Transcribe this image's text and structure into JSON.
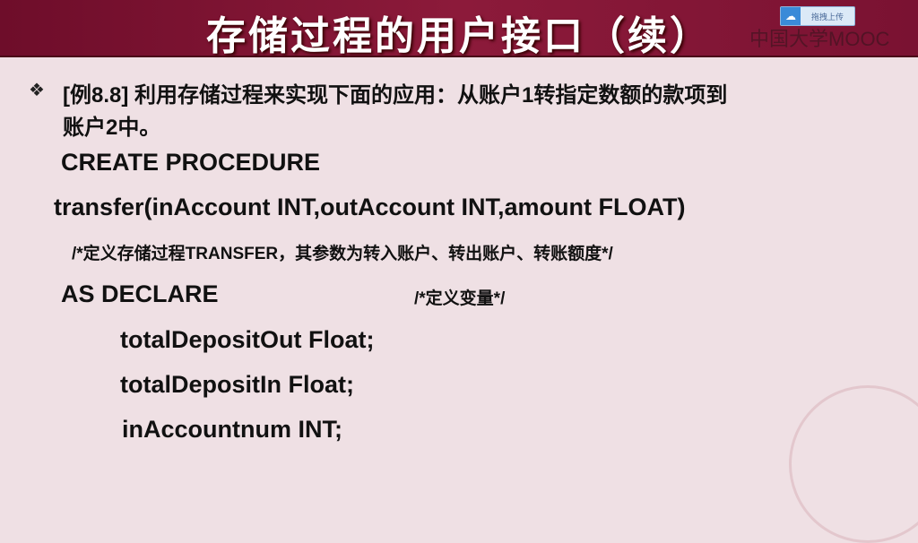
{
  "slide": {
    "title": "存储过程的用户接口（续）",
    "bullet_icon": "diamond-bullet-icon",
    "example_line1": "[例8.8] 利用存储过程来实现下面的应用：从账户1转指定数额的款项到",
    "example_line2": "账户2中。",
    "code": [
      "CREATE PROCEDURE",
      "transfer(inAccount INT,outAccount  INT,amount FLOAT)",
      "/*定义存储过程TRANSFER，其参数为转入账户、转出账户、转账额度*/",
      "AS DECLARE",
      "/*定义变量*/",
      "totalDepositOut Float;",
      "totalDepositIn Float;",
      "inAccountnum INT;"
    ]
  },
  "overlay": {
    "upload_label": "拖拽上传",
    "watermark": "中国大学MOOC"
  }
}
